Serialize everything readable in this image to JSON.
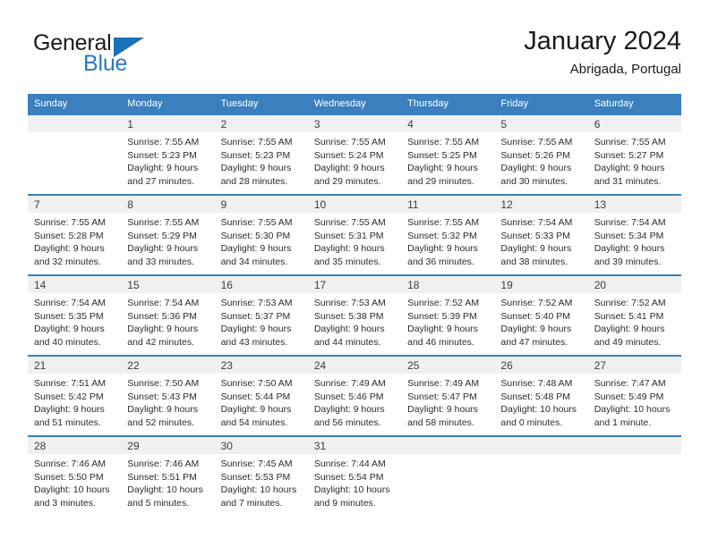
{
  "brand": {
    "name_top": "General",
    "name_bottom": "Blue",
    "flag_icon": "triangle-flag-icon",
    "accent_color": "#2a7ac0"
  },
  "header": {
    "title": "January 2024",
    "location": "Abrigada, Portugal"
  },
  "theme": {
    "header_blue": "#3b7fbe",
    "day_band_gray": "#f0f0f0",
    "text_color": "#2b2b2b"
  },
  "weekdays": [
    "Sunday",
    "Monday",
    "Tuesday",
    "Wednesday",
    "Thursday",
    "Friday",
    "Saturday"
  ],
  "weeks": [
    [
      {
        "day": "",
        "sunrise": "",
        "sunset": "",
        "daylight": "",
        "empty": true
      },
      {
        "day": "1",
        "sunrise": "Sunrise: 7:55 AM",
        "sunset": "Sunset: 5:23 PM",
        "daylight": "Daylight: 9 hours and 27 minutes."
      },
      {
        "day": "2",
        "sunrise": "Sunrise: 7:55 AM",
        "sunset": "Sunset: 5:23 PM",
        "daylight": "Daylight: 9 hours and 28 minutes."
      },
      {
        "day": "3",
        "sunrise": "Sunrise: 7:55 AM",
        "sunset": "Sunset: 5:24 PM",
        "daylight": "Daylight: 9 hours and 29 minutes."
      },
      {
        "day": "4",
        "sunrise": "Sunrise: 7:55 AM",
        "sunset": "Sunset: 5:25 PM",
        "daylight": "Daylight: 9 hours and 29 minutes."
      },
      {
        "day": "5",
        "sunrise": "Sunrise: 7:55 AM",
        "sunset": "Sunset: 5:26 PM",
        "daylight": "Daylight: 9 hours and 30 minutes."
      },
      {
        "day": "6",
        "sunrise": "Sunrise: 7:55 AM",
        "sunset": "Sunset: 5:27 PM",
        "daylight": "Daylight: 9 hours and 31 minutes."
      }
    ],
    [
      {
        "day": "7",
        "sunrise": "Sunrise: 7:55 AM",
        "sunset": "Sunset: 5:28 PM",
        "daylight": "Daylight: 9 hours and 32 minutes."
      },
      {
        "day": "8",
        "sunrise": "Sunrise: 7:55 AM",
        "sunset": "Sunset: 5:29 PM",
        "daylight": "Daylight: 9 hours and 33 minutes."
      },
      {
        "day": "9",
        "sunrise": "Sunrise: 7:55 AM",
        "sunset": "Sunset: 5:30 PM",
        "daylight": "Daylight: 9 hours and 34 minutes."
      },
      {
        "day": "10",
        "sunrise": "Sunrise: 7:55 AM",
        "sunset": "Sunset: 5:31 PM",
        "daylight": "Daylight: 9 hours and 35 minutes."
      },
      {
        "day": "11",
        "sunrise": "Sunrise: 7:55 AM",
        "sunset": "Sunset: 5:32 PM",
        "daylight": "Daylight: 9 hours and 36 minutes."
      },
      {
        "day": "12",
        "sunrise": "Sunrise: 7:54 AM",
        "sunset": "Sunset: 5:33 PM",
        "daylight": "Daylight: 9 hours and 38 minutes."
      },
      {
        "day": "13",
        "sunrise": "Sunrise: 7:54 AM",
        "sunset": "Sunset: 5:34 PM",
        "daylight": "Daylight: 9 hours and 39 minutes."
      }
    ],
    [
      {
        "day": "14",
        "sunrise": "Sunrise: 7:54 AM",
        "sunset": "Sunset: 5:35 PM",
        "daylight": "Daylight: 9 hours and 40 minutes."
      },
      {
        "day": "15",
        "sunrise": "Sunrise: 7:54 AM",
        "sunset": "Sunset: 5:36 PM",
        "daylight": "Daylight: 9 hours and 42 minutes."
      },
      {
        "day": "16",
        "sunrise": "Sunrise: 7:53 AM",
        "sunset": "Sunset: 5:37 PM",
        "daylight": "Daylight: 9 hours and 43 minutes."
      },
      {
        "day": "17",
        "sunrise": "Sunrise: 7:53 AM",
        "sunset": "Sunset: 5:38 PM",
        "daylight": "Daylight: 9 hours and 44 minutes."
      },
      {
        "day": "18",
        "sunrise": "Sunrise: 7:52 AM",
        "sunset": "Sunset: 5:39 PM",
        "daylight": "Daylight: 9 hours and 46 minutes."
      },
      {
        "day": "19",
        "sunrise": "Sunrise: 7:52 AM",
        "sunset": "Sunset: 5:40 PM",
        "daylight": "Daylight: 9 hours and 47 minutes."
      },
      {
        "day": "20",
        "sunrise": "Sunrise: 7:52 AM",
        "sunset": "Sunset: 5:41 PM",
        "daylight": "Daylight: 9 hours and 49 minutes."
      }
    ],
    [
      {
        "day": "21",
        "sunrise": "Sunrise: 7:51 AM",
        "sunset": "Sunset: 5:42 PM",
        "daylight": "Daylight: 9 hours and 51 minutes."
      },
      {
        "day": "22",
        "sunrise": "Sunrise: 7:50 AM",
        "sunset": "Sunset: 5:43 PM",
        "daylight": "Daylight: 9 hours and 52 minutes."
      },
      {
        "day": "23",
        "sunrise": "Sunrise: 7:50 AM",
        "sunset": "Sunset: 5:44 PM",
        "daylight": "Daylight: 9 hours and 54 minutes."
      },
      {
        "day": "24",
        "sunrise": "Sunrise: 7:49 AM",
        "sunset": "Sunset: 5:46 PM",
        "daylight": "Daylight: 9 hours and 56 minutes."
      },
      {
        "day": "25",
        "sunrise": "Sunrise: 7:49 AM",
        "sunset": "Sunset: 5:47 PM",
        "daylight": "Daylight: 9 hours and 58 minutes."
      },
      {
        "day": "26",
        "sunrise": "Sunrise: 7:48 AM",
        "sunset": "Sunset: 5:48 PM",
        "daylight": "Daylight: 10 hours and 0 minutes."
      },
      {
        "day": "27",
        "sunrise": "Sunrise: 7:47 AM",
        "sunset": "Sunset: 5:49 PM",
        "daylight": "Daylight: 10 hours and 1 minute."
      }
    ],
    [
      {
        "day": "28",
        "sunrise": "Sunrise: 7:46 AM",
        "sunset": "Sunset: 5:50 PM",
        "daylight": "Daylight: 10 hours and 3 minutes."
      },
      {
        "day": "29",
        "sunrise": "Sunrise: 7:46 AM",
        "sunset": "Sunset: 5:51 PM",
        "daylight": "Daylight: 10 hours and 5 minutes."
      },
      {
        "day": "30",
        "sunrise": "Sunrise: 7:45 AM",
        "sunset": "Sunset: 5:53 PM",
        "daylight": "Daylight: 10 hours and 7 minutes."
      },
      {
        "day": "31",
        "sunrise": "Sunrise: 7:44 AM",
        "sunset": "Sunset: 5:54 PM",
        "daylight": "Daylight: 10 hours and 9 minutes."
      },
      {
        "day": "",
        "sunrise": "",
        "sunset": "",
        "daylight": "",
        "empty": true
      },
      {
        "day": "",
        "sunrise": "",
        "sunset": "",
        "daylight": "",
        "empty": true
      },
      {
        "day": "",
        "sunrise": "",
        "sunset": "",
        "daylight": "",
        "empty": true
      }
    ]
  ]
}
